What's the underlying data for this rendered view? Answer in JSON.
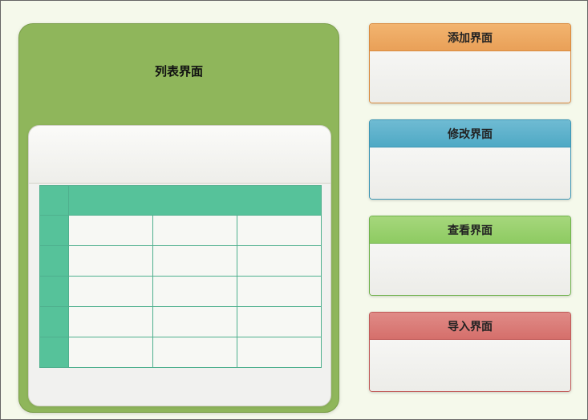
{
  "main": {
    "title": "列表界面"
  },
  "panels": {
    "add": {
      "title": "添加界面"
    },
    "edit": {
      "title": "修改界面"
    },
    "view": {
      "title": "查看界面"
    },
    "import": {
      "title": "导入界面"
    }
  },
  "table": {
    "columns": 3,
    "rows": 5
  }
}
